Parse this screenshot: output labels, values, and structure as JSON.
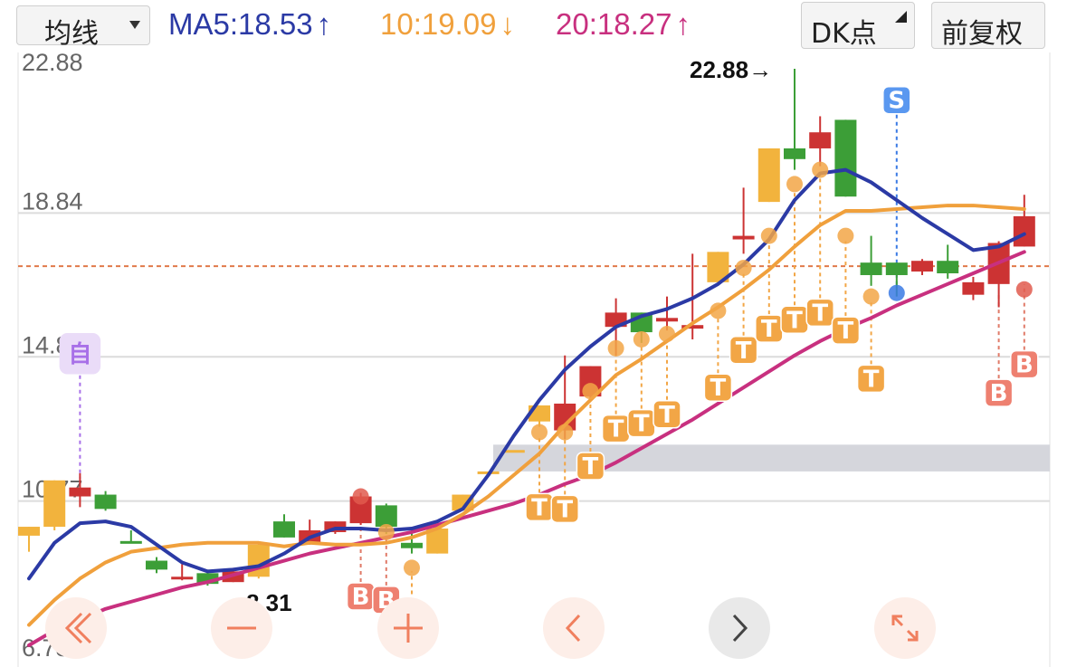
{
  "toolbar": {
    "indicator_select": "均线",
    "ma5": {
      "label": "MA5:18.53",
      "arrow": "↑",
      "color": "#2b3aa5"
    },
    "ma10": {
      "label": "10:19.09",
      "arrow": "↓",
      "color": "#f0a03c"
    },
    "ma20": {
      "label": "20:18.27",
      "arrow": "↑",
      "color": "#c8307f"
    },
    "dk_button": "DK点",
    "adjust_button": "前复权"
  },
  "chart_data": {
    "type": "candlestick",
    "y_ticks": [
      "22.88",
      "18.84",
      "14.81",
      "10.77",
      "6.73"
    ],
    "ylim": [
      6.73,
      22.88
    ],
    "current_price_line": 17.35,
    "max_annotation": "22.88→",
    "min_annotation": "←8.31",
    "colors": {
      "up": "#cc3333",
      "down": "#3c9e37",
      "flat": "#f2b33d",
      "ma5": "#2b3aa5",
      "ma10": "#f0a03c",
      "ma20": "#c8307f",
      "grid": "#dcdcdc",
      "zone": "#d5d6dc",
      "price_line": "#e07a4a"
    },
    "zone": {
      "low": 11.6,
      "high": 12.35
    },
    "candles": [
      {
        "o": 9.8,
        "c": 10.05,
        "h": 10.05,
        "l": 9.35,
        "k": "flat"
      },
      {
        "o": 10.05,
        "c": 11.35,
        "h": 11.35,
        "l": 9.95,
        "k": "flat"
      },
      {
        "o": 10.9,
        "c": 11.15,
        "h": 11.55,
        "l": 10.6,
        "k": "up"
      },
      {
        "o": 10.95,
        "c": 10.55,
        "h": 11.05,
        "l": 10.5,
        "k": "down"
      },
      {
        "o": 9.65,
        "c": 9.65,
        "h": 9.95,
        "l": 9.6,
        "k": "down"
      },
      {
        "o": 9.1,
        "c": 8.85,
        "h": 9.2,
        "l": 8.75,
        "k": "down"
      },
      {
        "o": 8.65,
        "c": 8.65,
        "h": 9.0,
        "l": 8.55,
        "k": "up"
      },
      {
        "o": 8.75,
        "c": 8.45,
        "h": 8.85,
        "l": 8.4,
        "k": "down"
      },
      {
        "o": 8.5,
        "c": 8.8,
        "h": 8.9,
        "l": 8.5,
        "k": "up"
      },
      {
        "o": 8.65,
        "c": 9.55,
        "h": 9.6,
        "l": 8.6,
        "k": "flat"
      },
      {
        "o": 10.2,
        "c": 9.75,
        "h": 10.4,
        "l": 9.75,
        "k": "down"
      },
      {
        "o": 9.6,
        "c": 9.95,
        "h": 10.25,
        "l": 9.55,
        "k": "up"
      },
      {
        "o": 9.9,
        "c": 10.2,
        "h": 10.2,
        "l": 9.85,
        "k": "up"
      },
      {
        "o": 10.15,
        "c": 10.9,
        "h": 11.0,
        "l": 10.1,
        "k": "up"
      },
      {
        "o": 10.65,
        "c": 10.05,
        "h": 10.7,
        "l": 9.85,
        "k": "down"
      },
      {
        "o": 9.6,
        "c": 9.45,
        "h": 10.0,
        "l": 9.3,
        "k": "down"
      },
      {
        "o": 9.3,
        "c": 10.0,
        "h": 10.0,
        "l": 9.3,
        "k": "flat"
      },
      {
        "o": 10.5,
        "c": 10.95,
        "h": 10.95,
        "l": 10.5,
        "k": "flat"
      },
      {
        "o": 11.6,
        "c": 11.6,
        "h": 11.6,
        "l": 11.6,
        "k": "flat"
      },
      {
        "o": 12.2,
        "c": 12.2,
        "h": 12.2,
        "l": 12.2,
        "k": "flat"
      },
      {
        "o": 13.0,
        "c": 13.45,
        "h": 13.45,
        "l": 12.85,
        "k": "flat"
      },
      {
        "o": 12.75,
        "c": 13.5,
        "h": 14.85,
        "l": 12.5,
        "k": "up"
      },
      {
        "o": 13.7,
        "c": 14.55,
        "h": 14.55,
        "l": 13.65,
        "k": "up"
      },
      {
        "o": 15.65,
        "c": 16.05,
        "h": 16.45,
        "l": 14.85,
        "k": "up"
      },
      {
        "o": 16.05,
        "c": 15.5,
        "h": 16.05,
        "l": 15.2,
        "k": "down"
      },
      {
        "o": 15.8,
        "c": 15.9,
        "h": 16.5,
        "l": 15.55,
        "k": "up"
      },
      {
        "o": 15.7,
        "c": 15.6,
        "h": 17.7,
        "l": 15.3,
        "k": "up"
      },
      {
        "o": 16.9,
        "c": 17.75,
        "h": 17.75,
        "l": 16.85,
        "k": "flat"
      },
      {
        "o": 18.1,
        "c": 18.2,
        "h": 19.55,
        "l": 17.7,
        "k": "up"
      },
      {
        "o": 19.15,
        "c": 20.65,
        "h": 20.65,
        "l": 19.15,
        "k": "flat"
      },
      {
        "o": 20.35,
        "c": 20.65,
        "h": 22.88,
        "l": 20.05,
        "k": "down"
      },
      {
        "o": 20.65,
        "c": 21.1,
        "h": 21.55,
        "l": 20.15,
        "k": "up"
      },
      {
        "o": 21.45,
        "c": 19.3,
        "h": 21.45,
        "l": 19.3,
        "k": "down"
      },
      {
        "o": 17.45,
        "c": 17.1,
        "h": 18.2,
        "l": 16.8,
        "k": "down"
      },
      {
        "o": 17.45,
        "c": 17.1,
        "h": 17.45,
        "l": 16.5,
        "k": "down"
      },
      {
        "o": 17.2,
        "c": 17.5,
        "h": 17.55,
        "l": 17.1,
        "k": "up"
      },
      {
        "o": 17.5,
        "c": 17.15,
        "h": 17.95,
        "l": 17.0,
        "k": "down"
      },
      {
        "o": 16.9,
        "c": 16.55,
        "h": 17.05,
        "l": 16.4,
        "k": "up"
      },
      {
        "o": 16.85,
        "c": 18.0,
        "h": 18.05,
        "l": 16.2,
        "k": "up"
      },
      {
        "o": 17.9,
        "c": 18.75,
        "h": 19.35,
        "l": 17.9,
        "k": "up"
      }
    ],
    "ma5": [
      8.6,
      9.6,
      10.15,
      10.2,
      10.05,
      9.55,
      9.05,
      8.8,
      8.85,
      8.95,
      9.3,
      9.75,
      10.0,
      10.0,
      9.95,
      10.0,
      10.2,
      10.55,
      11.5,
      12.6,
      13.6,
      14.45,
      15.1,
      15.65,
      15.95,
      16.15,
      16.45,
      16.85,
      17.4,
      18.1,
      19.2,
      19.95,
      20.05,
      19.7,
      19.2,
      18.7,
      18.25,
      17.8,
      17.9,
      18.25
    ],
    "ma10": [
      7.3,
      8.0,
      8.6,
      9.05,
      9.35,
      9.45,
      9.55,
      9.6,
      9.6,
      9.6,
      9.5,
      9.6,
      9.55,
      9.55,
      9.6,
      9.75,
      10.0,
      10.4,
      10.9,
      11.5,
      12.1,
      12.9,
      13.6,
      14.3,
      14.75,
      15.25,
      15.75,
      16.2,
      16.7,
      17.25,
      17.9,
      18.5,
      18.9,
      18.9,
      18.95,
      19.0,
      19.05,
      19.05,
      19.0,
      18.95
    ],
    "ma20": [
      6.73,
      7.15,
      7.45,
      7.75,
      7.95,
      8.15,
      8.35,
      8.5,
      8.7,
      8.9,
      9.1,
      9.3,
      9.45,
      9.6,
      9.75,
      9.9,
      10.1,
      10.3,
      10.5,
      10.7,
      10.95,
      11.25,
      11.5,
      11.85,
      12.25,
      12.65,
      13.05,
      13.5,
      13.95,
      14.4,
      14.85,
      15.25,
      15.6,
      15.9,
      16.25,
      16.55,
      16.85,
      17.15,
      17.45,
      17.75
    ],
    "dots": [
      {
        "i": 13,
        "v": 10.9,
        "c": "#e05a4e"
      },
      {
        "i": 14,
        "v": 9.9,
        "c": "#f2a646"
      },
      {
        "i": 15,
        "v": 8.9,
        "c": "#f2a646"
      },
      {
        "i": 20,
        "v": 12.7,
        "c": "#f2a646"
      },
      {
        "i": 21,
        "v": 12.7,
        "c": "#f2a646"
      },
      {
        "i": 22,
        "v": 13.85,
        "c": "#f2a646"
      },
      {
        "i": 23,
        "v": 15.05,
        "c": "#f2a646"
      },
      {
        "i": 24,
        "v": 15.3,
        "c": "#f2a646"
      },
      {
        "i": 25,
        "v": 15.45,
        "c": "#f2a646"
      },
      {
        "i": 27,
        "v": 16.1,
        "c": "#f2a646"
      },
      {
        "i": 28,
        "v": 17.3,
        "c": "#f2a646"
      },
      {
        "i": 29,
        "v": 18.2,
        "c": "#f2a646"
      },
      {
        "i": 30,
        "v": 19.65,
        "c": "#f2a646"
      },
      {
        "i": 31,
        "v": 20.05,
        "c": "#f2a646"
      },
      {
        "i": 32,
        "v": 18.2,
        "c": "#f2a646"
      },
      {
        "i": 33,
        "v": 16.5,
        "c": "#f2a646"
      },
      {
        "i": 34,
        "v": 16.6,
        "c": "#3a7ae4"
      },
      {
        "i": 39,
        "v": 16.7,
        "c": "#e05a4e"
      }
    ],
    "markers": [
      {
        "i": 2,
        "v": 14.9,
        "label": "自",
        "kind": "start",
        "line_to": 11.4
      },
      {
        "i": 13,
        "v": 8.1,
        "label": "B",
        "kind": "buy",
        "line_to": 10.7
      },
      {
        "i": 14,
        "v": 8.0,
        "label": "B",
        "kind": "buy",
        "line_to": 9.7
      },
      {
        "i": 15,
        "v": 7.35,
        "label": "T",
        "kind": "t",
        "line_to": 8.8
      },
      {
        "i": 20,
        "v": 10.6,
        "label": "T",
        "kind": "t",
        "line_to": 12.55
      },
      {
        "i": 21,
        "v": 10.55,
        "label": "T",
        "kind": "t",
        "line_to": 12.5
      },
      {
        "i": 22,
        "v": 11.75,
        "label": "T",
        "kind": "t",
        "line_to": 13.7
      },
      {
        "i": 23,
        "v": 12.8,
        "label": "T",
        "kind": "t",
        "line_to": 14.9
      },
      {
        "i": 24,
        "v": 12.95,
        "label": "T",
        "kind": "t",
        "line_to": 15.15
      },
      {
        "i": 25,
        "v": 13.2,
        "label": "T",
        "kind": "t",
        "line_to": 15.3
      },
      {
        "i": 27,
        "v": 13.95,
        "label": "T",
        "kind": "t",
        "line_to": 15.95
      },
      {
        "i": 28,
        "v": 15.0,
        "label": "T",
        "kind": "t",
        "line_to": 17.15
      },
      {
        "i": 29,
        "v": 15.6,
        "label": "T",
        "kind": "t",
        "line_to": 18.05
      },
      {
        "i": 30,
        "v": 15.85,
        "label": "T",
        "kind": "t",
        "line_to": 19.5
      },
      {
        "i": 31,
        "v": 16.05,
        "label": "T",
        "kind": "t",
        "line_to": 19.9
      },
      {
        "i": 32,
        "v": 15.55,
        "label": "T",
        "kind": "t",
        "line_to": 18.05
      },
      {
        "i": 33,
        "v": 14.2,
        "label": "T",
        "kind": "t",
        "line_to": 16.35
      },
      {
        "i": 34,
        "v": 22.0,
        "label": "S",
        "kind": "sell",
        "line_to": 16.75
      },
      {
        "i": 38,
        "v": 13.8,
        "label": "B",
        "kind": "buy",
        "line_to": 16.55
      },
      {
        "i": 39,
        "v": 14.6,
        "label": "B",
        "kind": "buy",
        "line_to": 16.85
      }
    ]
  },
  "controls": [
    {
      "name": "scroll-left-end",
      "icon": "double-chevron-left-icon"
    },
    {
      "name": "zoom-out",
      "icon": "minus-icon"
    },
    {
      "name": "zoom-in",
      "icon": "plus-icon"
    },
    {
      "name": "scroll-left",
      "icon": "chevron-left-icon"
    },
    {
      "name": "scroll-right",
      "icon": "chevron-right-icon"
    },
    {
      "name": "fullscreen",
      "icon": "expand-icon"
    }
  ]
}
